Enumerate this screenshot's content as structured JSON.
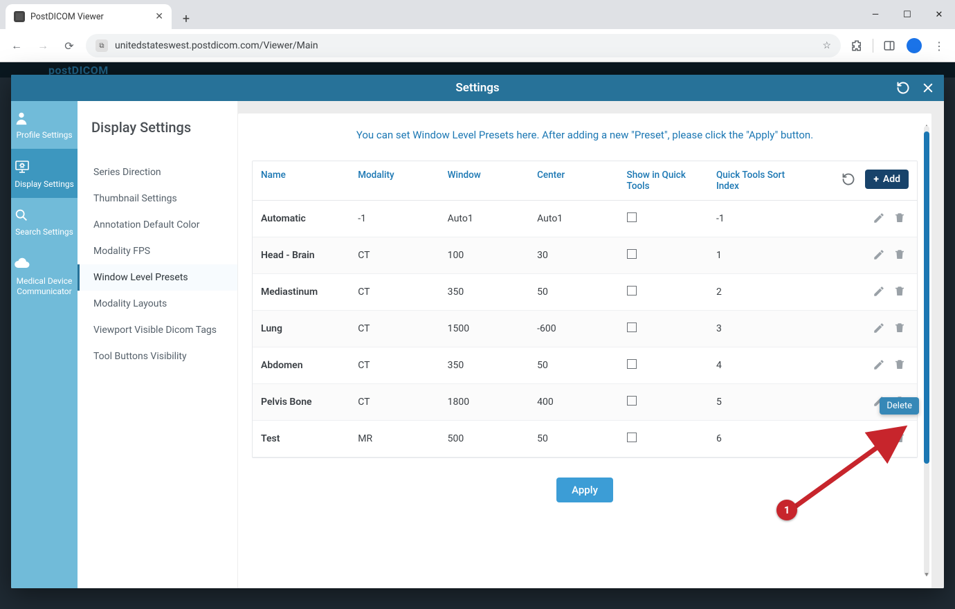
{
  "browser": {
    "tab_title": "PostDICOM Viewer",
    "url": "unitedstateswest.postdicom.com/Viewer/Main"
  },
  "app": {
    "logo": "postDICOM"
  },
  "modal": {
    "title": "Settings",
    "sidebar": [
      {
        "label": "Profile Settings"
      },
      {
        "label": "Display Settings"
      },
      {
        "label": "Search Settings"
      },
      {
        "label": "Medical Device Communicator"
      }
    ],
    "page_title": "Display Settings",
    "submenu": [
      "Series Direction",
      "Thumbnail Settings",
      "Annotation Default Color",
      "Modality FPS",
      "Window Level Presets",
      "Modality Layouts",
      "Viewport Visible Dicom Tags",
      "Tool Buttons Visibility"
    ],
    "active_submenu": "Window Level Presets",
    "hint": "You can set Window Level Presets here. After adding a new \"Preset\", please click the \"Apply\" button.",
    "columns": {
      "name": "Name",
      "modality": "Modality",
      "window": "Window",
      "center": "Center",
      "show": "Show in Quick Tools",
      "sort": "Quick Tools Sort Index"
    },
    "add_label": "Add",
    "apply_label": "Apply",
    "tooltip": "Delete",
    "rows": [
      {
        "name": "Automatic",
        "modality": "-1",
        "window": "Auto1",
        "center": "Auto1",
        "show": false,
        "sort": "-1"
      },
      {
        "name": "Head - Brain",
        "modality": "CT",
        "window": "100",
        "center": "30",
        "show": false,
        "sort": "1"
      },
      {
        "name": "Mediastinum",
        "modality": "CT",
        "window": "350",
        "center": "50",
        "show": false,
        "sort": "2"
      },
      {
        "name": "Lung",
        "modality": "CT",
        "window": "1500",
        "center": "-600",
        "show": false,
        "sort": "3"
      },
      {
        "name": "Abdomen",
        "modality": "CT",
        "window": "350",
        "center": "50",
        "show": false,
        "sort": "4"
      },
      {
        "name": "Pelvis Bone",
        "modality": "CT",
        "window": "1800",
        "center": "400",
        "show": false,
        "sort": "5"
      },
      {
        "name": "Test",
        "modality": "MR",
        "window": "500",
        "center": "50",
        "show": false,
        "sort": "6"
      }
    ]
  },
  "annotation": {
    "badge": "1"
  }
}
